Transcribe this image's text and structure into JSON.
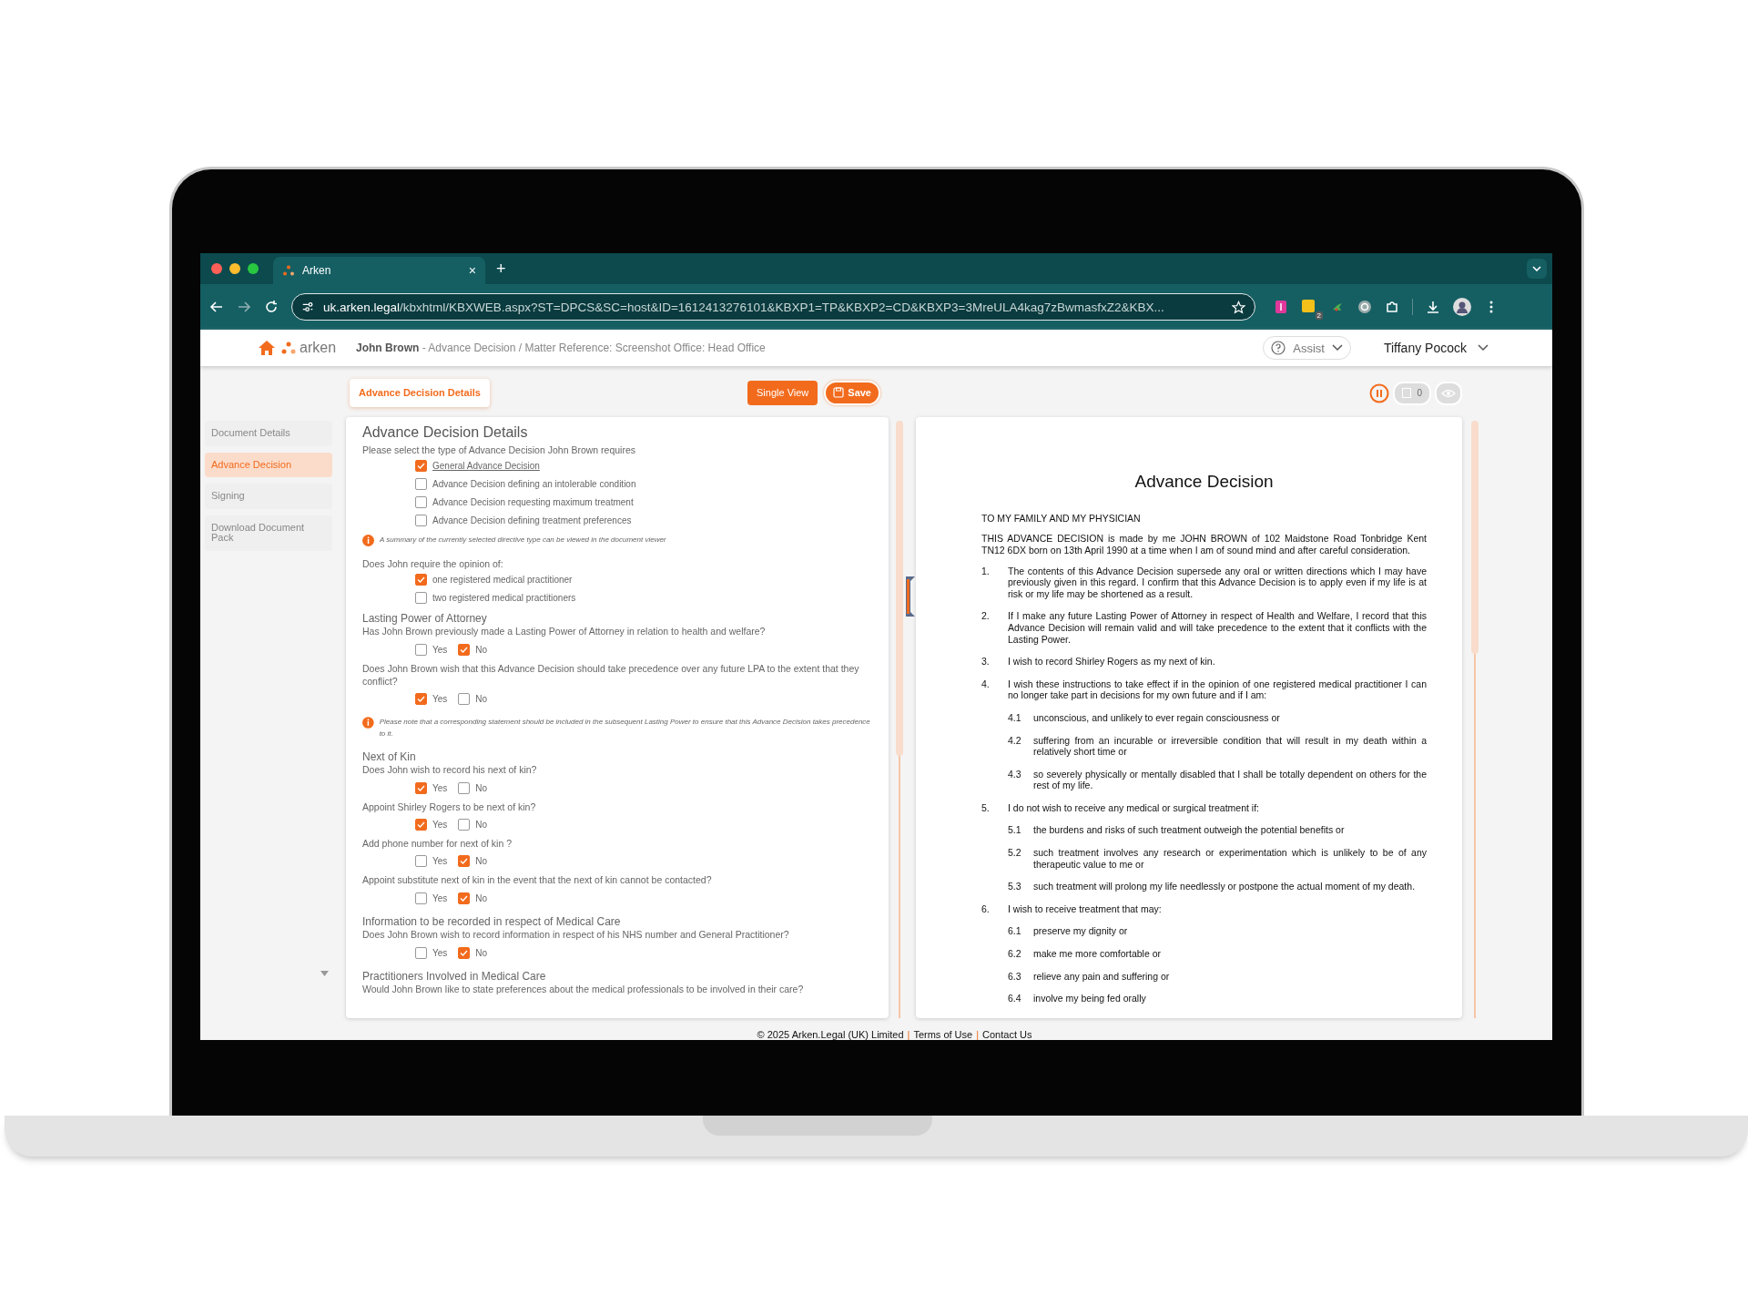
{
  "browser": {
    "tab": {
      "title": "Arken",
      "close": "×"
    },
    "new_tab": "+",
    "url_host": "uk.arken.legal",
    "url_path": "/kbxhtml/KBXWEB.aspx?ST=DPCS&SC=host&ID=1612413276101&KBXP1=TP&KBXP2=CD&KBXP3=3MreULA4kag7zBwmasfxZ2&KBX...",
    "extension_badge": "2"
  },
  "header": {
    "logo": "arken",
    "breadcrumb": "**John Brown** - Advance Decision / Matter Reference: Screenshot Office: Head Office",
    "assist": "Assist",
    "user": "Tiffany Pocock"
  },
  "toolbar": {
    "section_tab": "Advance Decision Details",
    "buttons": [
      "Single View",
      "Save"
    ],
    "counter": "0"
  },
  "sidebar": {
    "items": [
      {
        "label": "Document Details",
        "selected": false
      },
      {
        "label": "Advance Decision",
        "selected": true
      },
      {
        "label": "Signing",
        "selected": false
      },
      {
        "label": "Download Document Pack",
        "selected": false
      }
    ]
  },
  "form": {
    "blocks": [
      {
        "kind": "heading",
        "text": "Advance Decision Details"
      },
      {
        "kind": "text",
        "text": "Please select the type of Advance Decision John Brown requires"
      },
      {
        "kind": "check",
        "label": "General Advance Decision",
        "checked": true,
        "link": true
      },
      {
        "kind": "check",
        "label": "Advance Decision defining an intolerable condition",
        "checked": false,
        "link": false
      },
      {
        "kind": "check",
        "label": "Advance Decision requesting maximum treatment",
        "checked": false,
        "link": false
      },
      {
        "kind": "check",
        "label": "Advance Decision defining treatment preferences",
        "checked": false,
        "link": false
      },
      {
        "kind": "note",
        "text": "A summary of the currently selected directive type can be viewed in the document viewer"
      },
      {
        "kind": "text",
        "text": "Does John require the opinion of:"
      },
      {
        "kind": "check",
        "label": "one registered medical practitioner",
        "checked": true,
        "link": false
      },
      {
        "kind": "check",
        "label": "two registered medical practitioners",
        "checked": false,
        "link": false
      },
      {
        "kind": "heading2",
        "text": "Lasting Power of Attorney"
      },
      {
        "kind": "text",
        "text": "Has John Brown previously made a Lasting Power of Attorney in relation to health and welfare?"
      },
      {
        "kind": "yesno",
        "options": [
          {
            "label": "Yes",
            "checked": false
          },
          {
            "label": "No",
            "checked": true
          }
        ]
      },
      {
        "kind": "text",
        "text": "Does John Brown wish that this Advance Decision should take precedence over any future LPA to the extent that they conflict?"
      },
      {
        "kind": "yesno",
        "options": [
          {
            "label": "Yes",
            "checked": true
          },
          {
            "label": "No",
            "checked": false
          }
        ]
      },
      {
        "kind": "note",
        "text": "Please note that a corresponding statement should be included in the subsequent Lasting Power to ensure that this Advance Decision takes precedence to it."
      },
      {
        "kind": "heading2",
        "text": "Next of Kin"
      },
      {
        "kind": "text",
        "text": "Does John wish to record his next of kin?"
      },
      {
        "kind": "yesno",
        "options": [
          {
            "label": "Yes",
            "checked": true
          },
          {
            "label": "No",
            "checked": false
          }
        ]
      },
      {
        "kind": "text",
        "text": "Appoint Shirley  Rogers to be next of kin?"
      },
      {
        "kind": "yesno",
        "options": [
          {
            "label": "Yes",
            "checked": true
          },
          {
            "label": "No",
            "checked": false
          }
        ]
      },
      {
        "kind": "text",
        "text": "Add phone number for next of kin ?"
      },
      {
        "kind": "yesno",
        "options": [
          {
            "label": "Yes",
            "checked": false
          },
          {
            "label": "No",
            "checked": true
          }
        ]
      },
      {
        "kind": "text",
        "text": "Appoint substitute next of kin in the event that the next of kin cannot be contacted?"
      },
      {
        "kind": "yesno",
        "options": [
          {
            "label": "Yes",
            "checked": false
          },
          {
            "label": "No",
            "checked": true
          }
        ]
      },
      {
        "kind": "heading2",
        "text": "Information to be recorded in respect of Medical Care"
      },
      {
        "kind": "text",
        "text": "Does John  Brown wish to record information in respect of his NHS number and General Practitioner?"
      },
      {
        "kind": "yesno",
        "options": [
          {
            "label": "Yes",
            "checked": false
          },
          {
            "label": "No",
            "checked": true
          }
        ]
      },
      {
        "kind": "heading2",
        "text": "Practitioners Involved in Medical Care"
      },
      {
        "kind": "text",
        "text": "Would John  Brown like to state preferences about the medical professionals to be involved in their care?"
      }
    ]
  },
  "document": {
    "title": "Advance Decision",
    "blocks": [
      {
        "kind": "para",
        "text": "TO MY FAMILY  AND MY PHYSICIAN"
      },
      {
        "kind": "para",
        "text": "THIS ADVANCE  DECISION is made by me JOHN BROWN of 102 Maidstone Road Tonbridge Kent TN12 6DX born on 13th April 1990 at a time when I am of sound mind and after careful consideration."
      },
      {
        "kind": "item",
        "num": "1.",
        "text": "The contents of this Advance Decision supersede any oral or written directions which I may have previously given in this regard. I confirm that this Advance Decision is to apply even if my life is at risk or my life may be shortened as a result."
      },
      {
        "kind": "item",
        "num": "2.",
        "text": "If I make any future Lasting Power of Attorney in respect of Health and Welfare, I record that this Advance Decision will remain valid and will take precedence to the extent that it conflicts with the Lasting Power."
      },
      {
        "kind": "item",
        "num": "3.",
        "text": "I wish to record Shirley Rogers  as my next of kin."
      },
      {
        "kind": "item",
        "num": "4.",
        "text": "I wish these instructions to take effect if in the opinion of one registered medical practitioner I can no longer take part in decisions for my own future and if I am:"
      },
      {
        "kind": "subitem",
        "num": "4.1",
        "text": "unconscious, and unlikely to ever regain consciousness  or"
      },
      {
        "kind": "subitem",
        "num": "4.2",
        "text": "suffering from an incurable or irreversible condition that will result in my death within a relatively short time or"
      },
      {
        "kind": "subitem",
        "num": "4.3",
        "text": "so severely physically or mentally disabled that I shall be totally dependent on others for the rest of my life."
      },
      {
        "kind": "item",
        "num": "5.",
        "text": "I do not wish to receive any medical or surgical treatment if:"
      },
      {
        "kind": "subitem",
        "num": "5.1",
        "text": "the burdens and risks of such treatment outweigh the potential benefits or"
      },
      {
        "kind": "subitem",
        "num": "5.2",
        "text": "such treatment involves any research or experimentation  which is unlikely to be of any therapeutic value to me or"
      },
      {
        "kind": "subitem",
        "num": "5.3",
        "text": "such treatment will prolong my life needlessly or postpone the actual moment of my death."
      },
      {
        "kind": "item",
        "num": "6.",
        "text": "I wish to receive treatment that may:"
      },
      {
        "kind": "subitem",
        "num": "6.1",
        "text": "preserve my dignity or"
      },
      {
        "kind": "subitem",
        "num": "6.2",
        "text": "make me more comfortable or"
      },
      {
        "kind": "subitem",
        "num": "6.3",
        "text": "relieve any pain and suffering or"
      },
      {
        "kind": "subitem",
        "num": "6.4",
        "text": "involve my being fed orally"
      }
    ]
  },
  "footer": {
    "links": [
      "© 2025 Arken.Legal (UK) Limited",
      "Terms of Use",
      "Contact Us"
    ],
    "separator": "|"
  }
}
